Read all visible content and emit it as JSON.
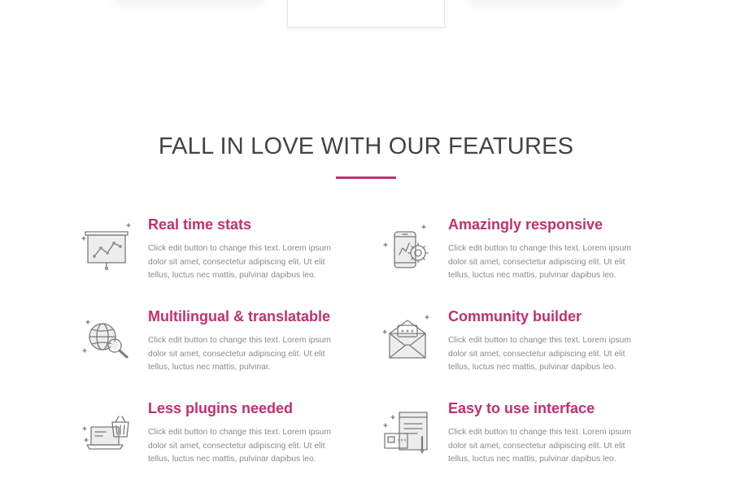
{
  "colors": {
    "accent": "#c2306e",
    "title_text": "#444444",
    "body_text": "#8a8a8a",
    "icon_gray": "#7a7a7a"
  },
  "section": {
    "title": "FALL IN LOVE WITH OUR FEATURES"
  },
  "features": [
    {
      "icon": "presentation-chart-icon",
      "title": "Real time stats",
      "description": "Click edit button to change this text. Lorem ipsum dolor sit amet, consectetur adipiscing elit. Ut elit tellus, luctus nec mattis, pulvinar dapibus leo."
    },
    {
      "icon": "mobile-gear-icon",
      "title": "Amazingly responsive",
      "description": "Click edit button to change this text. Lorem ipsum dolor sit amet, consectetur adipiscing elit. Ut elit tellus, luctus nec mattis, pulvinar dapibus leo."
    },
    {
      "icon": "globe-search-icon",
      "title": "Multilingual & translatable",
      "description": "Click edit button to change this text. Lorem ipsum dolor sit amet, consectetur adipiscing elit. Ut elit tellus, luctus nec mattis, pulvinar."
    },
    {
      "icon": "envelope-chat-icon",
      "title": "Community builder",
      "description": "Click edit button to change this text. Lorem ipsum dolor sit amet, consectetur adipiscing elit. Ut elit tellus, luctus nec mattis, pulvinar dapibus leo."
    },
    {
      "icon": "laptop-basket-icon",
      "title": "Less plugins needed",
      "description": "Click edit button to change this text. Lorem ipsum dolor sit amet, consectetur adipiscing elit. Ut elit tellus, luctus nec mattis, pulvinar dapibus leo."
    },
    {
      "icon": "document-pen-icon",
      "title": "Easy to use interface",
      "description": "Click edit button to change this text. Lorem ipsum dolor sit amet, consectetur adipiscing elit. Ut elit tellus, luctus nec mattis, pulvinar dapibus leo."
    }
  ]
}
